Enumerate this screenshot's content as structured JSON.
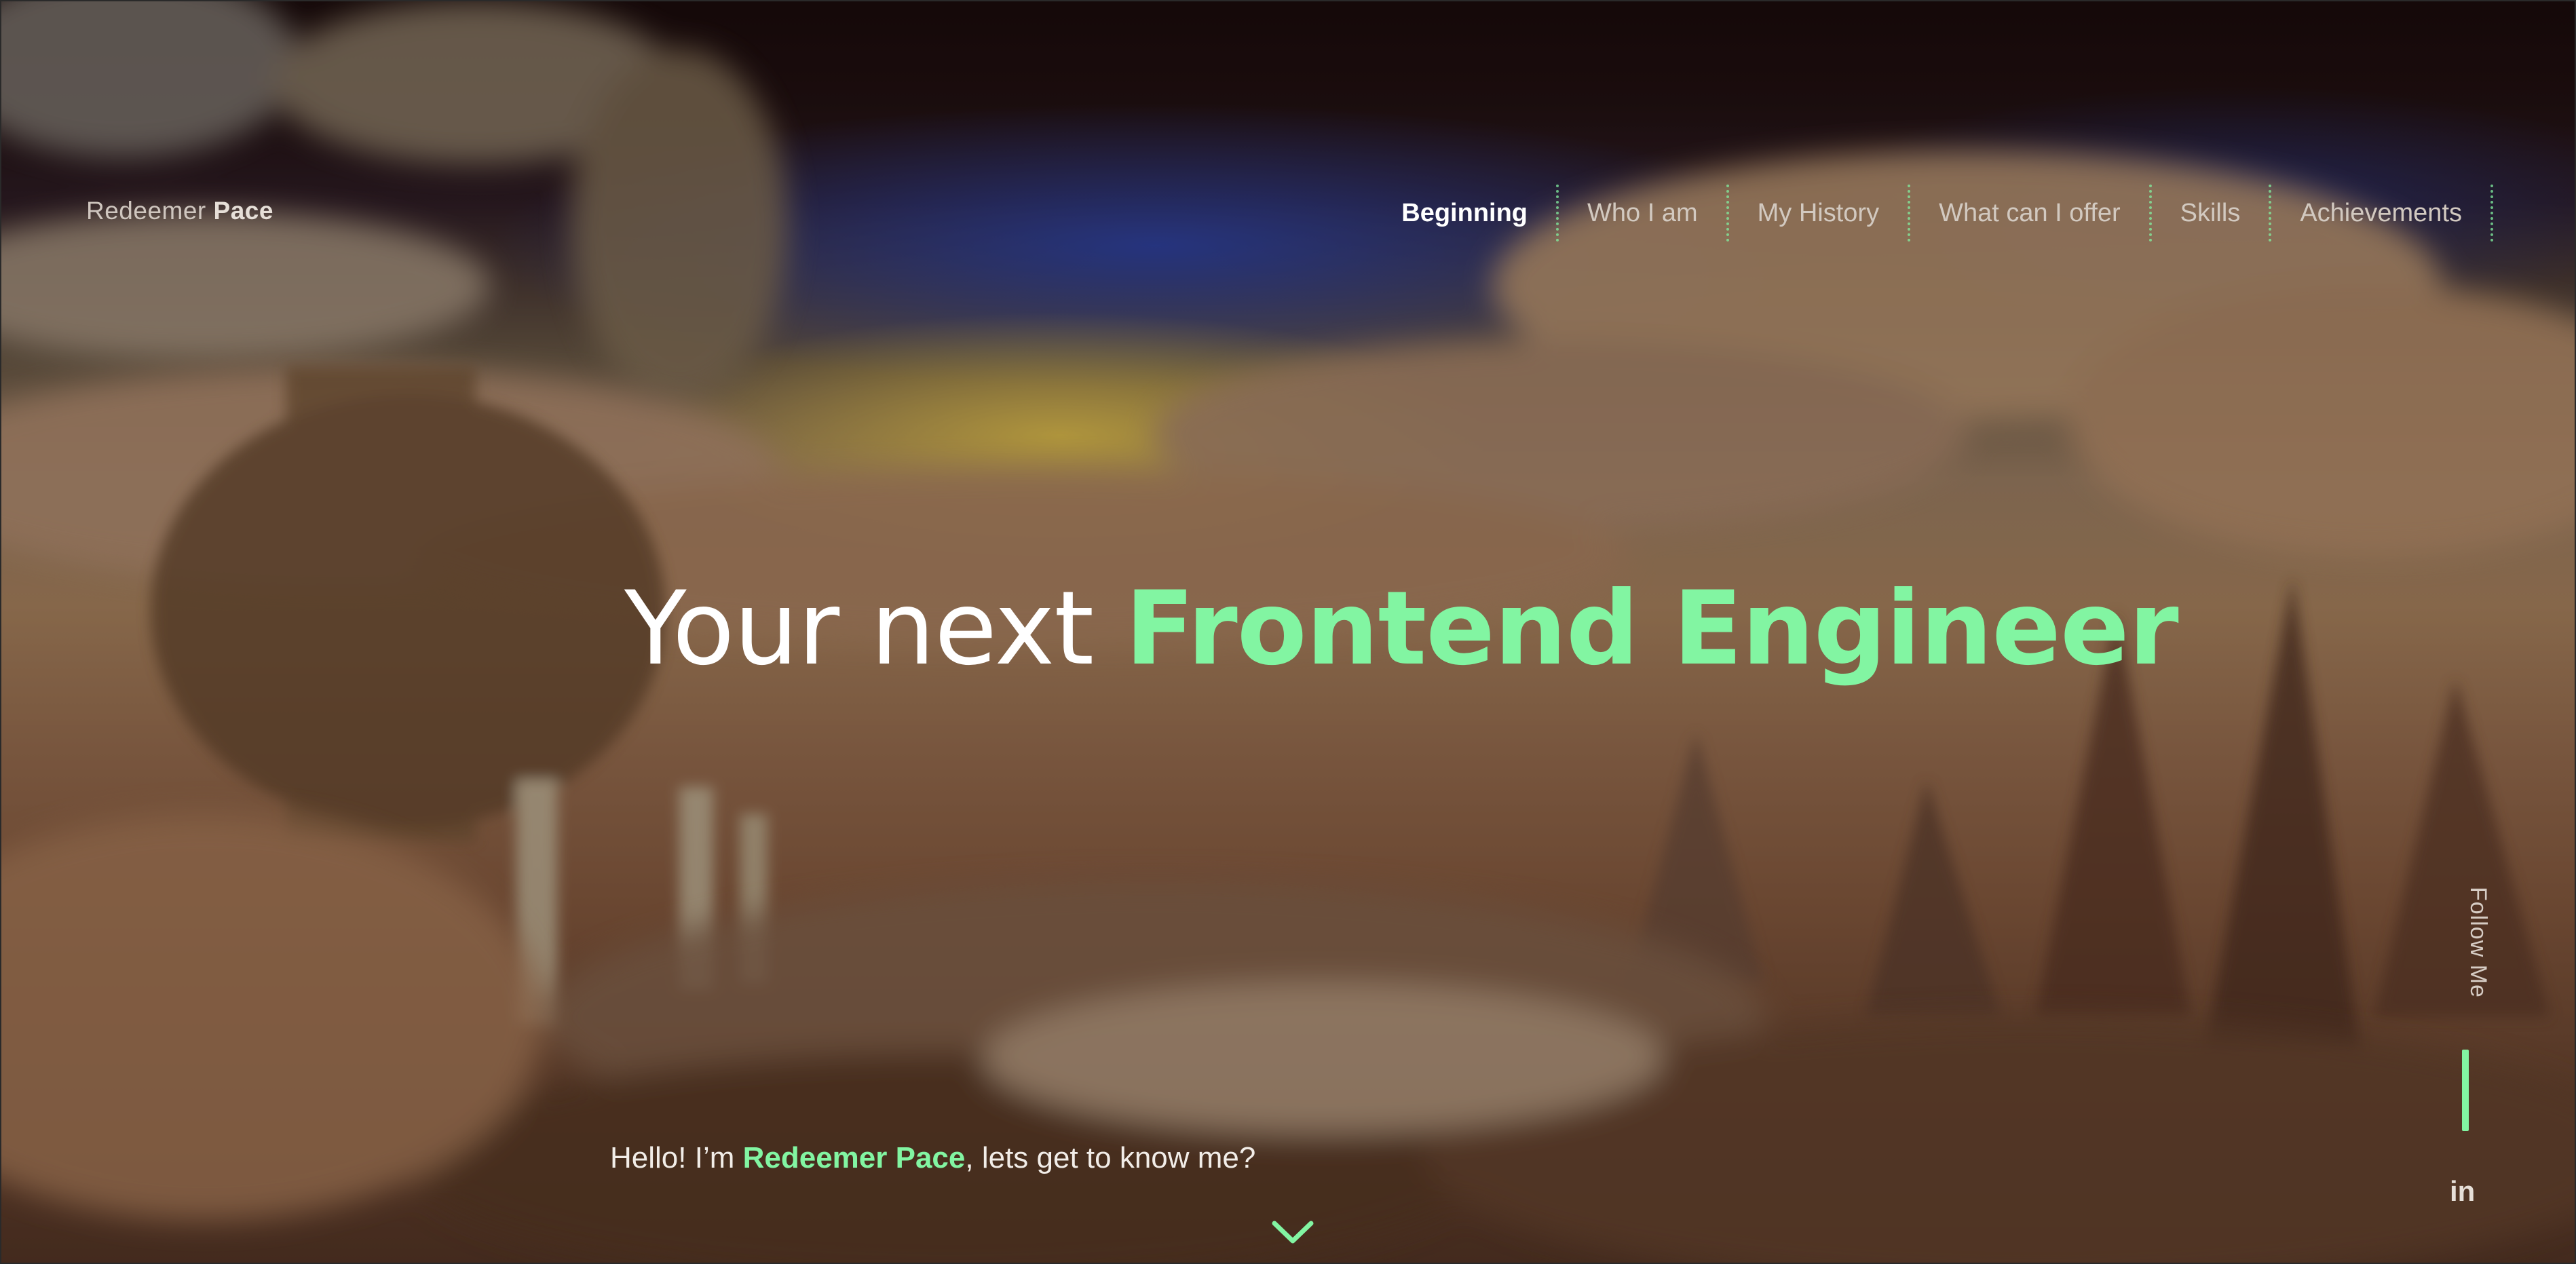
{
  "header": {
    "logo_first": "Redeemer",
    "logo_last": "Pace"
  },
  "nav": {
    "items": [
      {
        "label": "Beginning",
        "active": true
      },
      {
        "label": "Who I am",
        "active": false
      },
      {
        "label": "My History",
        "active": false
      },
      {
        "label": "What can I offer",
        "active": false
      },
      {
        "label": "Skills",
        "active": false
      },
      {
        "label": "Achievements",
        "active": false
      }
    ]
  },
  "hero": {
    "title_prefix": "Your next",
    "title_accent": "Frontend Engineer",
    "intro_prefix": "Hello! I’m",
    "intro_name": "Redeemer Pace",
    "intro_suffix": ", lets get to know me?",
    "scroll_icon": "chevron-down-icon"
  },
  "social": {
    "follow_label": "Follow Me",
    "linkedin_label": "in"
  },
  "colors": {
    "accent": "#82f5a2",
    "text": "#ffffff",
    "muted": "#d2c9c0"
  }
}
